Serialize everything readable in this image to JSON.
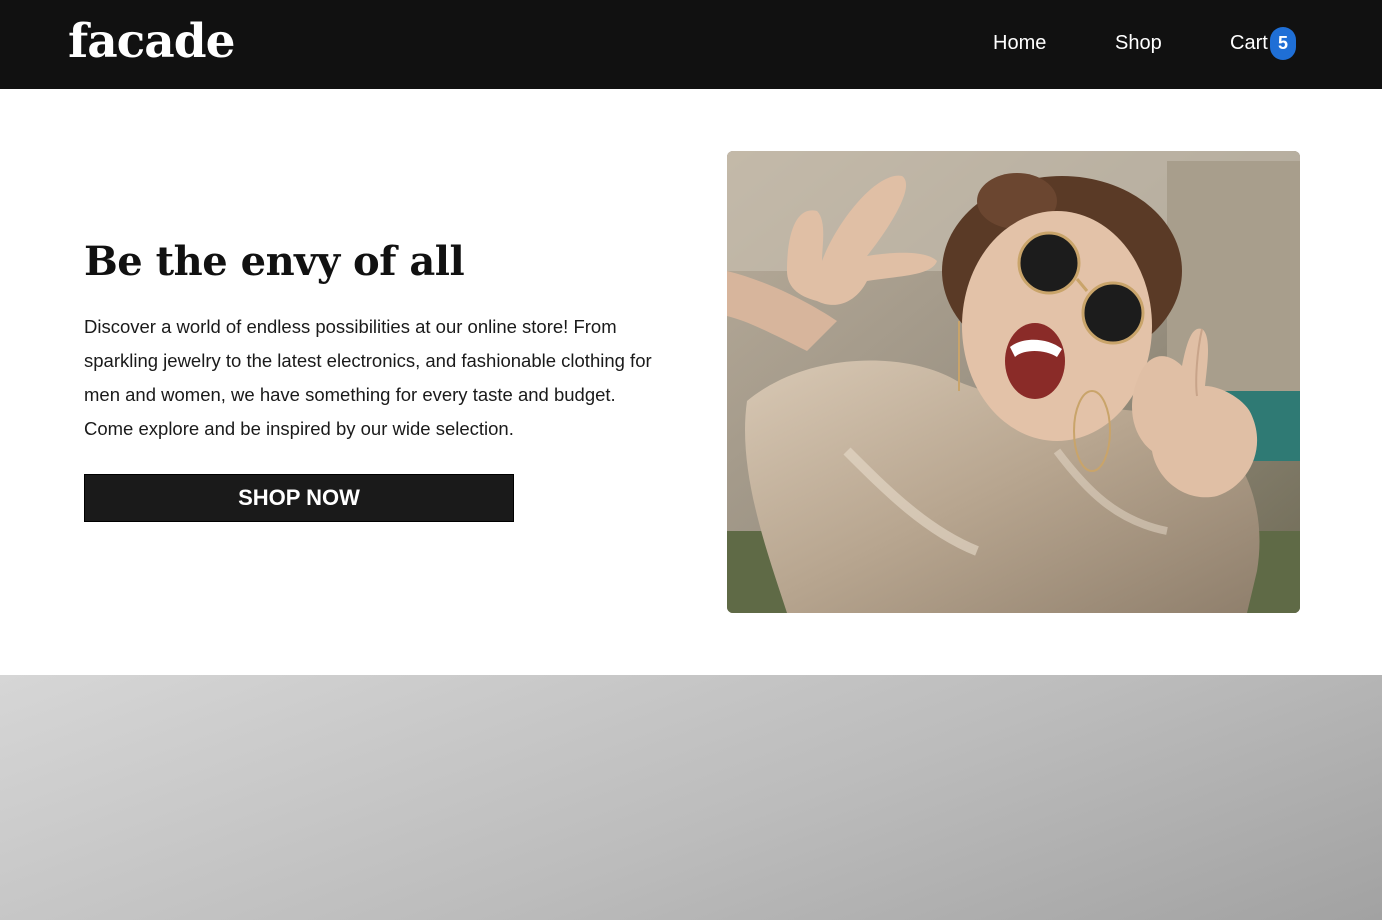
{
  "navbar": {
    "brand": "facade",
    "links": {
      "home": "Home",
      "shop": "Shop",
      "cart": "Cart"
    },
    "cart_count": "5",
    "background_color": "#111111",
    "badge_color": "#1f6fd6"
  },
  "hero": {
    "title": "Be the envy of all",
    "description": "Discover a world of endless possibilities at our online store! From sparkling jewelry to the latest electronics, and fashionable clothing for men and women, we have something for every taste and budget. Come explore and be inspired by our wide selection.",
    "cta_label": "SHOP NOW",
    "image_subject": "woman in sunglasses making peace signs"
  }
}
